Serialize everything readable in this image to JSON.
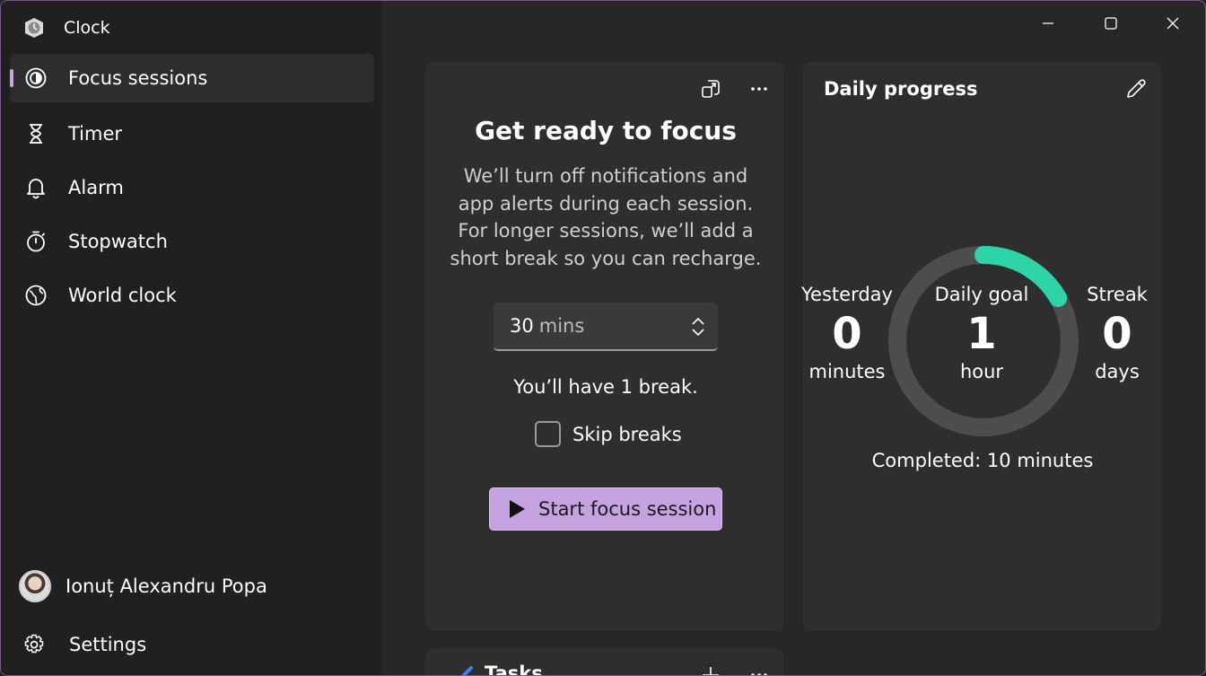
{
  "app": {
    "title": "Clock"
  },
  "sidebar": {
    "items": [
      {
        "label": "Focus sessions",
        "icon": "focus-icon",
        "selected": true
      },
      {
        "label": "Timer",
        "icon": "hourglass-icon"
      },
      {
        "label": "Alarm",
        "icon": "bell-icon"
      },
      {
        "label": "Stopwatch",
        "icon": "stopwatch-icon"
      },
      {
        "label": "World clock",
        "icon": "globe-icon"
      }
    ],
    "profile_name": "Ionuț Alexandru Popa",
    "settings_label": "Settings"
  },
  "focus": {
    "title": "Get ready to focus",
    "description": "We’ll turn off notifications and app alerts during each session. For longer sessions, we’ll add a short break so you can recharge.",
    "duration_value": "30",
    "duration_unit": "mins",
    "break_text": "You’ll have 1 break.",
    "skip_label": "Skip breaks",
    "skip_checked": false,
    "start_label": "Start focus session"
  },
  "progress": {
    "title": "Daily progress",
    "yesterday": {
      "label": "Yesterday",
      "value": "0",
      "unit": "minutes"
    },
    "goal": {
      "label": "Daily goal",
      "value": "1",
      "unit": "hour"
    },
    "streak": {
      "label": "Streak",
      "value": "0",
      "unit": "days"
    },
    "completed": "Completed: 10 minutes",
    "goal_fraction": 0.1667
  },
  "tasks": {
    "title": "Tasks"
  },
  "colors": {
    "accent": "#c5a3e0",
    "progress": "#2dd4a8",
    "ring_track": "#4d4d4d"
  }
}
